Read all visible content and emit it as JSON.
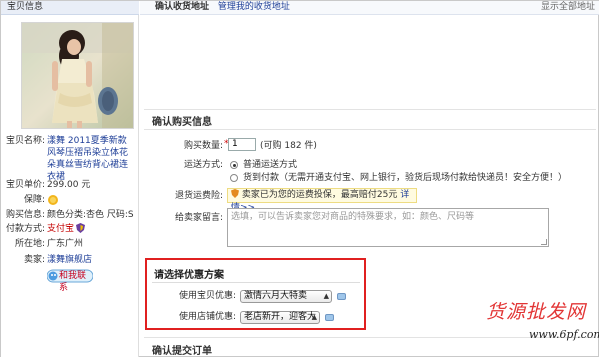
{
  "left": {
    "header": "宝贝信息",
    "product_name_label": "宝贝名称:",
    "product_name": "漾舞 2011夏季新款风琴压褶吊染立体花朵真丝雪纺背心裙连衣裙",
    "price_label": "宝贝单价:",
    "price": "299.00 元",
    "guarantee_label": "保障:",
    "attrs_label": "购买信息:",
    "attrs": "颜色分类:杏色 尺码:S",
    "pay_label": "付款方式:",
    "pay": "支付宝",
    "location_label": "所在地:",
    "location": "广东广州",
    "seller_label": "卖家:",
    "seller": "漾舞旗舰店",
    "wangwang": "和我联系"
  },
  "top": {
    "title": "确认收货地址",
    "link": "管理我的收货地址",
    "right": "显示全部地址"
  },
  "purchase": {
    "title": "确认购买信息",
    "qty_label": "购买数量:",
    "qty": "1",
    "qty_hint": "(可购 182 件)",
    "ship_label": "运送方式:",
    "ship_normal": "普通运送方式",
    "ship_cod": "货到付款（无需开通支付宝、网上银行，验货后现场付款给快递员！安全方便！）",
    "insurance_label": "退货运费险:",
    "insurance_text": "卖家已为您的运费投保，最高赔付25元",
    "insurance_link": "详情>>",
    "message_label": "给卖家留言:",
    "message_placeholder": "选填，可以告诉卖家您对商品的特殊要求，如：颜色、尺码等"
  },
  "promo": {
    "title": "请选择优惠方案",
    "item_label": "使用宝贝优惠:",
    "item_value": "激情六月大特卖",
    "shop_label": "使用店铺优惠:",
    "shop_value": "老店新开，迎客大"
  },
  "submit": {
    "title": "确认提交订单"
  },
  "watermark": {
    "brand": "货源批发网",
    "url": "www.6pf.com"
  }
}
